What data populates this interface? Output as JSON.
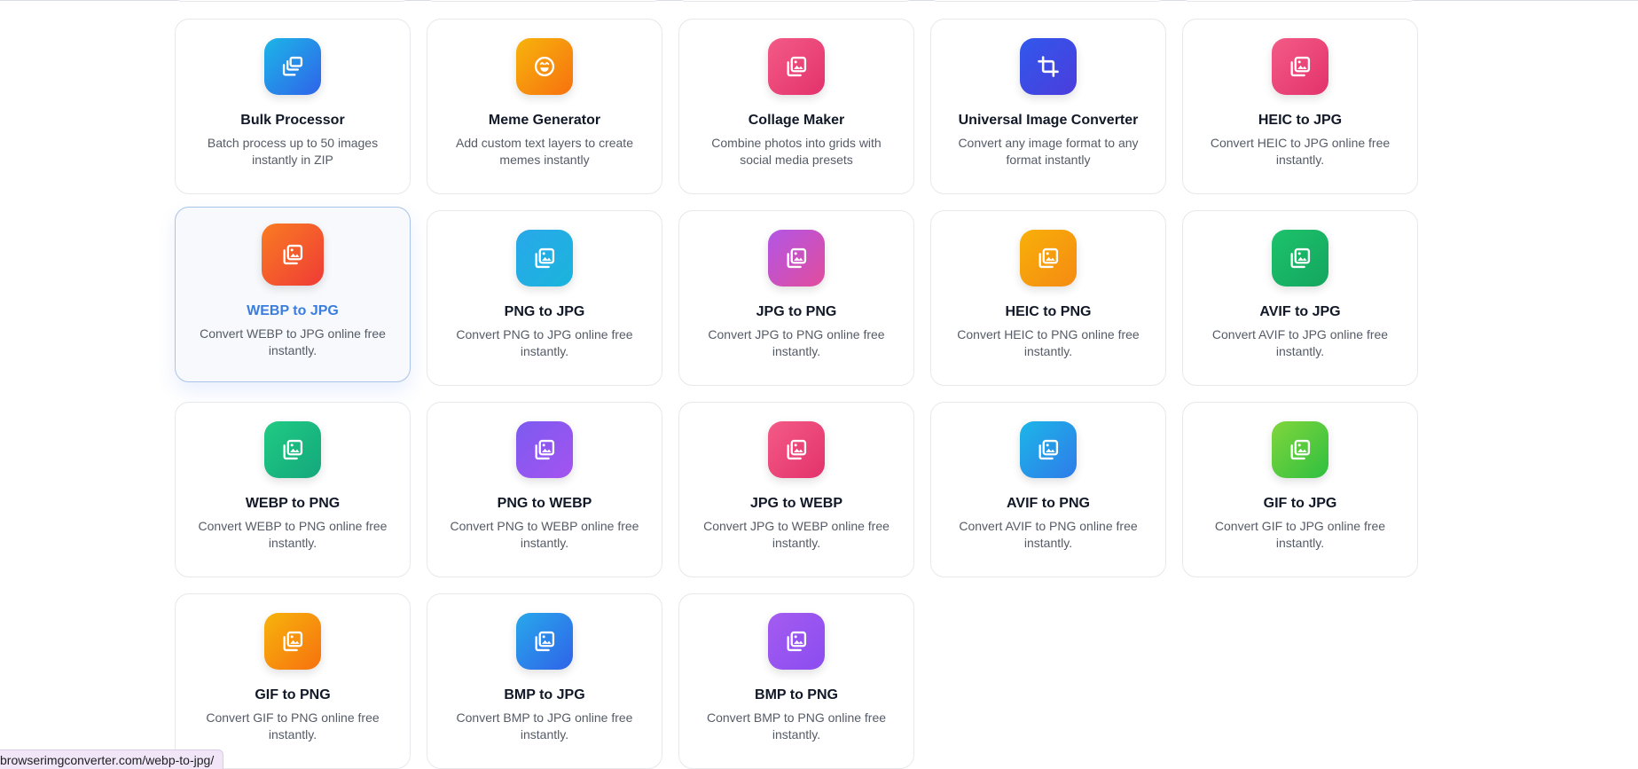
{
  "status_url": "browserimgconverter.com/webp-to-jpg/",
  "tools": [
    {
      "title": "Bulk Processor",
      "desc": "Batch process up to 50 images instantly in ZIP",
      "icon": "bulk-icon",
      "gradient": [
        "#1cb6e8",
        "#2f63e9"
      ],
      "active": false
    },
    {
      "title": "Meme Generator",
      "desc": "Add custom text layers to create memes instantly",
      "icon": "smile-icon",
      "gradient": [
        "#f7b40c",
        "#f7710f"
      ],
      "active": false
    },
    {
      "title": "Collage Maker",
      "desc": "Combine photos into grids with social media presets",
      "icon": "images-icon",
      "gradient": [
        "#f35b86",
        "#e3326c"
      ],
      "active": false
    },
    {
      "title": "Universal Image Converter",
      "desc": "Convert any image format to any format instantly",
      "icon": "crop-icon",
      "gradient": [
        "#3158ec",
        "#4b3ddc"
      ],
      "active": false
    },
    {
      "title": "HEIC to JPG",
      "desc": "Convert HEIC to JPG online free instantly.",
      "icon": "images-icon",
      "gradient": [
        "#f35b86",
        "#e3326c"
      ],
      "active": false
    },
    {
      "title": "WEBP to JPG",
      "desc": "Convert WEBP to JPG online free instantly.",
      "icon": "images-icon",
      "gradient": [
        "#f97c22",
        "#ef3b36"
      ],
      "active": true
    },
    {
      "title": "PNG to JPG",
      "desc": "Convert PNG to JPG online free instantly.",
      "icon": "images-icon",
      "gradient": [
        "#28a8ea",
        "#1bb4dc"
      ],
      "active": false
    },
    {
      "title": "JPG to PNG",
      "desc": "Convert JPG to PNG online free instantly.",
      "icon": "images-icon",
      "gradient": [
        "#b256e6",
        "#e14c9c"
      ],
      "active": false
    },
    {
      "title": "HEIC to PNG",
      "desc": "Convert HEIC to PNG online free instantly.",
      "icon": "images-icon",
      "gradient": [
        "#f8b008",
        "#f58a13"
      ],
      "active": false
    },
    {
      "title": "AVIF to JPG",
      "desc": "Convert AVIF to JPG online free instantly.",
      "icon": "images-icon",
      "gradient": [
        "#1dc26b",
        "#14a65f"
      ],
      "active": false
    },
    {
      "title": "WEBP to PNG",
      "desc": "Convert WEBP to PNG online free instantly.",
      "icon": "images-icon",
      "gradient": [
        "#1fcb83",
        "#14a77c"
      ],
      "active": false
    },
    {
      "title": "PNG to WEBP",
      "desc": "Convert PNG to WEBP online free instantly.",
      "icon": "images-icon",
      "gradient": [
        "#7c5bf0",
        "#a453f0"
      ],
      "active": false
    },
    {
      "title": "JPG to WEBP",
      "desc": "Convert JPG to WEBP online free instantly.",
      "icon": "images-icon",
      "gradient": [
        "#f35b86",
        "#e3326c"
      ],
      "active": false
    },
    {
      "title": "AVIF to PNG",
      "desc": "Convert AVIF to PNG online free instantly.",
      "icon": "images-icon",
      "gradient": [
        "#1cb6e8",
        "#2f7be9"
      ],
      "active": false
    },
    {
      "title": "GIF to JPG",
      "desc": "Convert GIF to JPG online free instantly.",
      "icon": "images-icon",
      "gradient": [
        "#80d63c",
        "#2fbf40"
      ],
      "active": false
    },
    {
      "title": "GIF to PNG",
      "desc": "Convert GIF to PNG online free instantly.",
      "icon": "images-icon",
      "gradient": [
        "#f7b40c",
        "#f7710f"
      ],
      "active": false
    },
    {
      "title": "BMP to JPG",
      "desc": "Convert BMP to JPG online free instantly.",
      "icon": "images-icon",
      "gradient": [
        "#28a8ea",
        "#2f63e9"
      ],
      "active": false
    },
    {
      "title": "BMP to PNG",
      "desc": "Convert BMP to PNG online free instantly.",
      "icon": "images-icon",
      "gradient": [
        "#a45cf0",
        "#8b4cf0"
      ],
      "active": false
    }
  ]
}
